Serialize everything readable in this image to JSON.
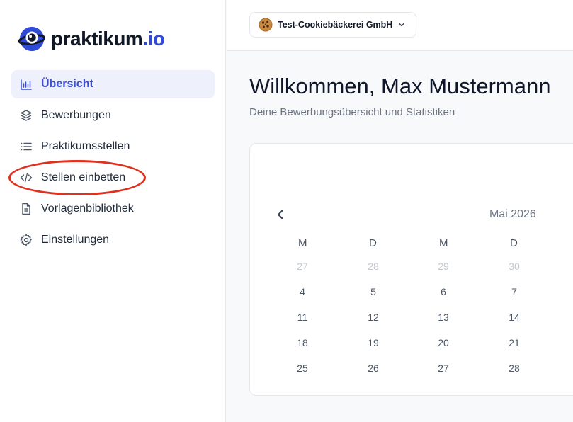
{
  "app": {
    "logo_text": "praktikum",
    "logo_tld": ".io"
  },
  "sidebar": {
    "items": [
      {
        "label": "Übersicht",
        "icon": "bar-chart-icon",
        "active": true
      },
      {
        "label": "Bewerbungen",
        "icon": "layers-icon",
        "active": false
      },
      {
        "label": "Praktikumsstellen",
        "icon": "list-icon",
        "active": false
      },
      {
        "label": "Stellen einbetten",
        "icon": "code-icon",
        "active": false
      },
      {
        "label": "Vorlagenbibliothek",
        "icon": "document-icon",
        "active": false
      },
      {
        "label": "Einstellungen",
        "icon": "gear-icon",
        "active": false
      }
    ]
  },
  "topbar": {
    "org_name": "Test-Cookiebäckerei GmbH",
    "org_icon": "cookie-icon"
  },
  "main": {
    "title": "Willkommen, Max Mustermann",
    "subtitle": "Deine Bewerbungsübersicht und Statistiken"
  },
  "calendar": {
    "month_label": "Mai 2026",
    "weekdays": [
      "M",
      "D",
      "M",
      "D"
    ],
    "weeks": [
      [
        "27",
        "28",
        "29",
        "30"
      ],
      [
        "4",
        "5",
        "6",
        "7"
      ],
      [
        "11",
        "12",
        "13",
        "14"
      ],
      [
        "18",
        "19",
        "20",
        "21"
      ],
      [
        "25",
        "26",
        "27",
        "28"
      ]
    ],
    "muted_week_index": 0
  },
  "colors": {
    "accent": "#3b4fd6",
    "highlight_ring": "#e0301e"
  }
}
